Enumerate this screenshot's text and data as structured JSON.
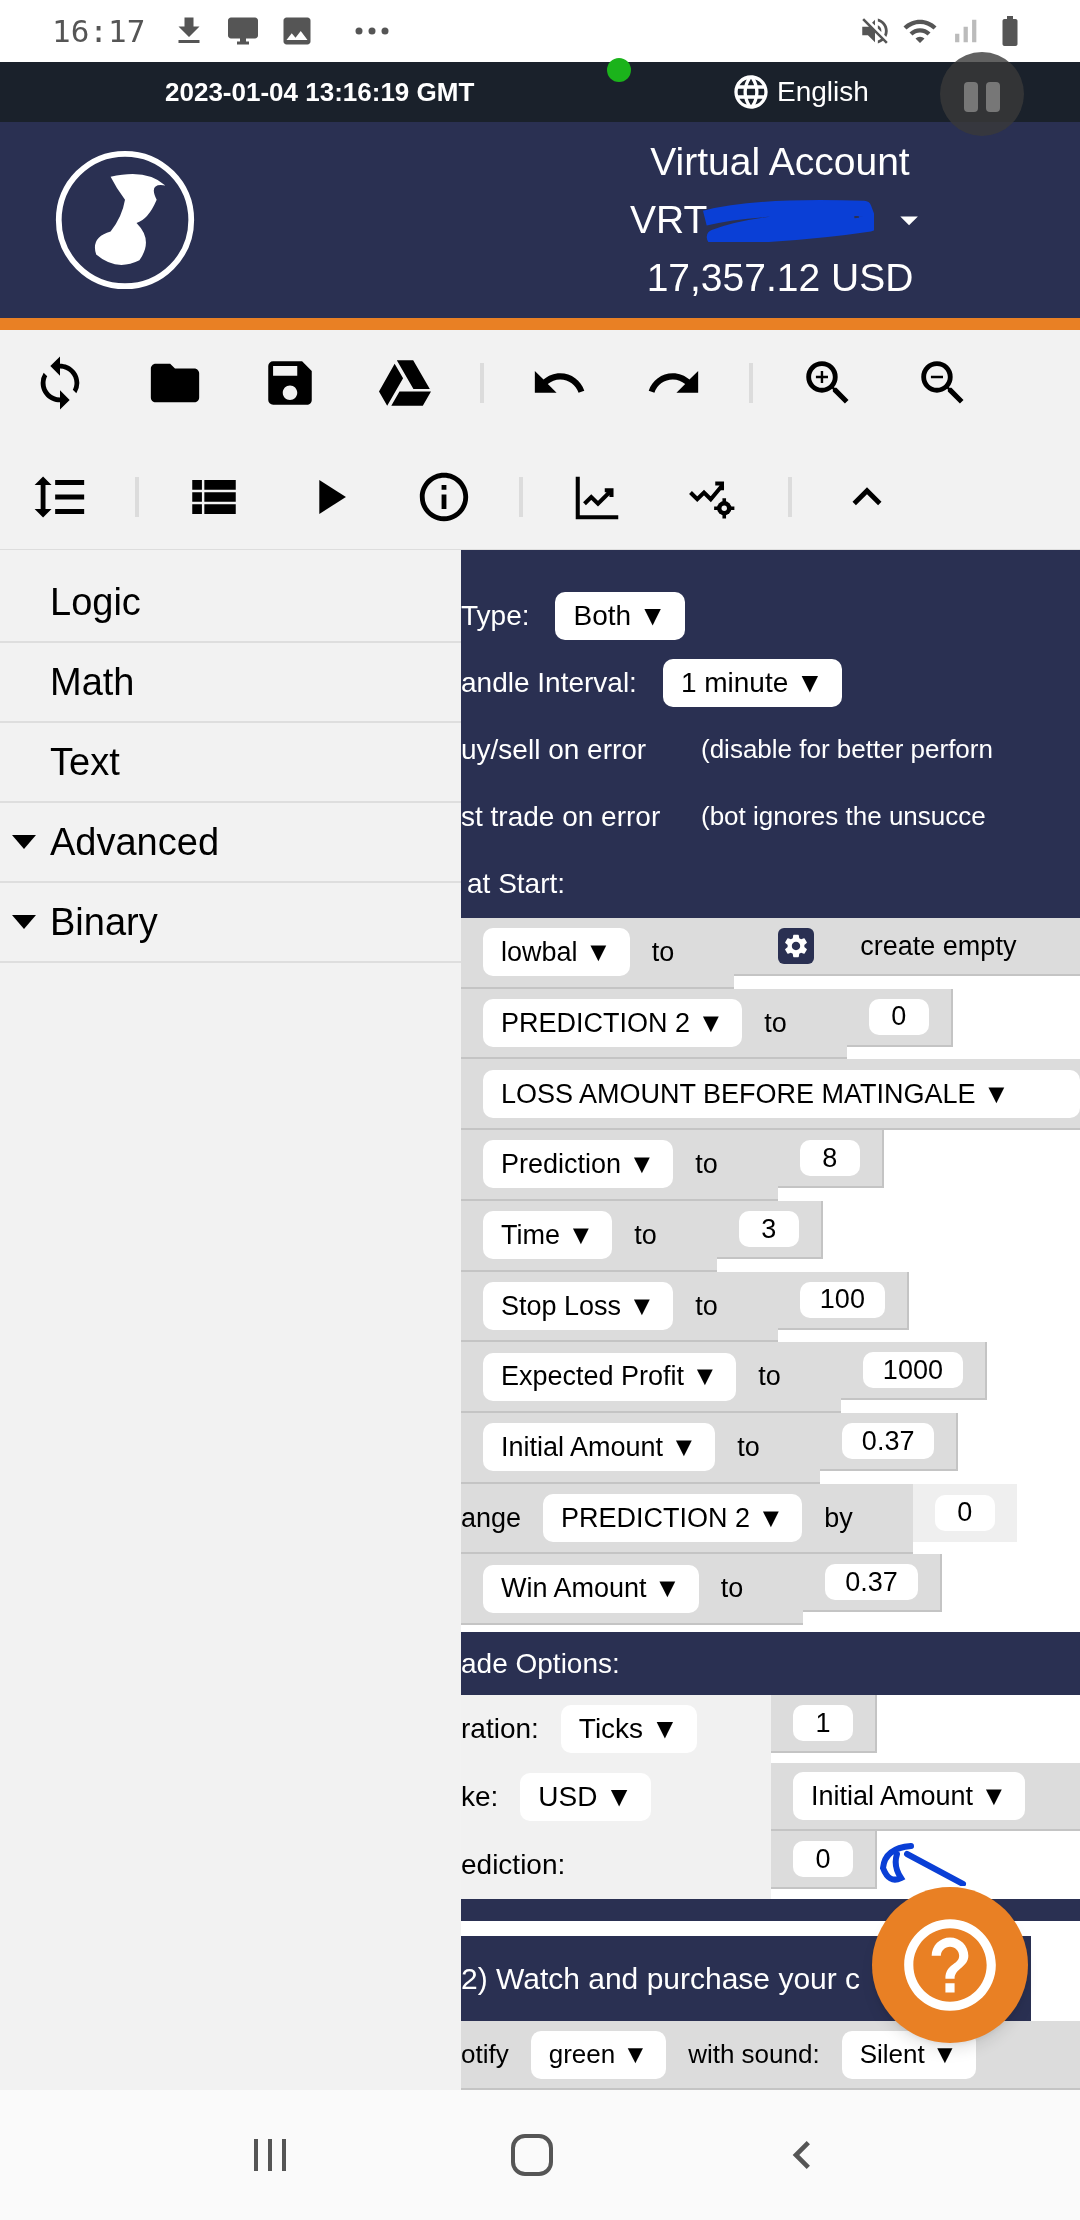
{
  "status_bar": {
    "time": "16:17"
  },
  "top_bar": {
    "datetime": "2023-01-04 13:16:19 GMT",
    "online": true,
    "language": "English"
  },
  "account": {
    "title": "Virtual Account",
    "id": "VRT",
    "balance": "17,357.12 USD"
  },
  "sidebar": {
    "items": [
      {
        "label": "Logic",
        "expandable": false
      },
      {
        "label": "Math",
        "expandable": false
      },
      {
        "label": "Text",
        "expandable": false
      },
      {
        "label": "Advanced",
        "expandable": true
      },
      {
        "label": "Binary",
        "expandable": true
      }
    ]
  },
  "trade_parameters": {
    "rows": [
      {
        "label": "Type:",
        "dropdown": "Both ▼"
      },
      {
        "label": "andle Interval:",
        "dropdown": "1 minute ▼"
      },
      {
        "label": "uy/sell on error",
        "note": "(disable for better perforn"
      },
      {
        "label": "st trade on error",
        "note": "(bot ignores the unsucce"
      }
    ],
    "footer": "at Start:"
  },
  "blocks": [
    {
      "kind": "set_list",
      "name": "lowbal ▼",
      "word": "to",
      "value": "create empty"
    },
    {
      "kind": "set",
      "name": "PREDICTION 2 ▼",
      "word": "to",
      "value": "0"
    },
    {
      "kind": "get",
      "name": "LOSS AMOUNT BEFORE MATINGALE ▼"
    },
    {
      "kind": "set",
      "name": "Prediction ▼",
      "word": "to",
      "value": "8"
    },
    {
      "kind": "set",
      "name": "Time ▼",
      "word": "to",
      "value": "3"
    },
    {
      "kind": "set",
      "name": "Stop Loss ▼",
      "word": "to",
      "value": "100"
    },
    {
      "kind": "set",
      "name": "Expected Profit ▼",
      "word": "to",
      "value": "1000"
    },
    {
      "kind": "set",
      "name": "Initial Amount ▼",
      "word": "to",
      "value": "0.37"
    },
    {
      "kind": "change",
      "prefix": "ange",
      "name": "PREDICTION 2 ▼",
      "word": "by",
      "value": "0"
    },
    {
      "kind": "set",
      "name": "Win Amount ▼",
      "word": "to",
      "value": "0.37"
    }
  ],
  "trade_options": {
    "title": "ade Options:",
    "rows": [
      {
        "label": "ration:",
        "dropdown": "Ticks ▼",
        "value": "1",
        "kind": "number"
      },
      {
        "label": "ke:",
        "dropdown": "USD ▼",
        "value": "Initial Amount ▼",
        "kind": "variable"
      },
      {
        "label": "ediction:",
        "value": "0",
        "kind": "number"
      }
    ]
  },
  "watch_purchase": {
    "title": "2) Watch and purchase your c",
    "prefix": "otify",
    "color_choice": "green ▼",
    "word": "with sound:",
    "sound": "Silent ▼"
  }
}
